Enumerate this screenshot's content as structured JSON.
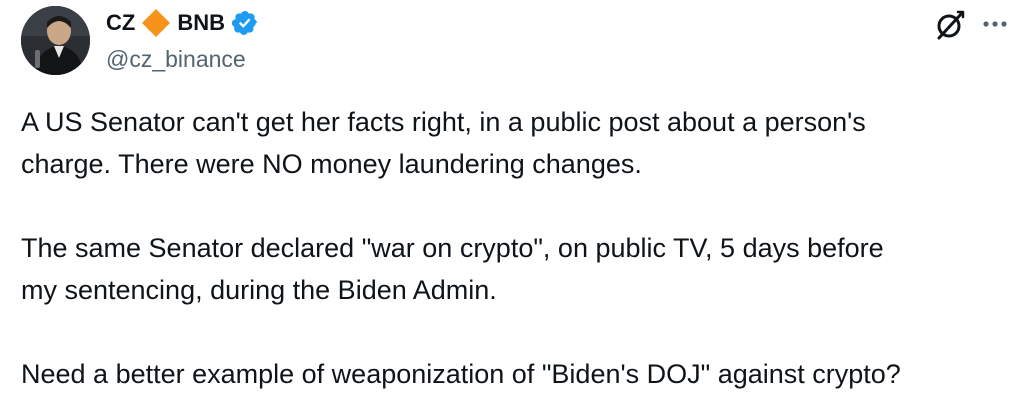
{
  "author": {
    "name_prefix": "CZ",
    "name_suffix": "BNB",
    "handle": "@cz_binance",
    "avatar_icon": "profile-photo",
    "badge_icon": "orange-diamond-icon",
    "verified_icon": "blue-verified-checkmark-icon",
    "accent_color": "#f7931a",
    "verified_color": "#1d9bf0"
  },
  "actions": {
    "grok_icon": "grok-icon",
    "more_icon": "more-options-icon"
  },
  "tweet": {
    "paragraphs": [
      {
        "lines": [
          "A US Senator can't get her facts right, in a public post about a person's",
          "charge. There were NO money laundering changes."
        ]
      },
      {
        "lines": [
          "The same Senator declared \"war on crypto\", on public TV, 5 days before",
          "my sentencing, during the Biden Admin."
        ]
      },
      {
        "lines": [
          "Need a better example of weaponization of \"Biden's DOJ\" against crypto?"
        ]
      }
    ]
  }
}
